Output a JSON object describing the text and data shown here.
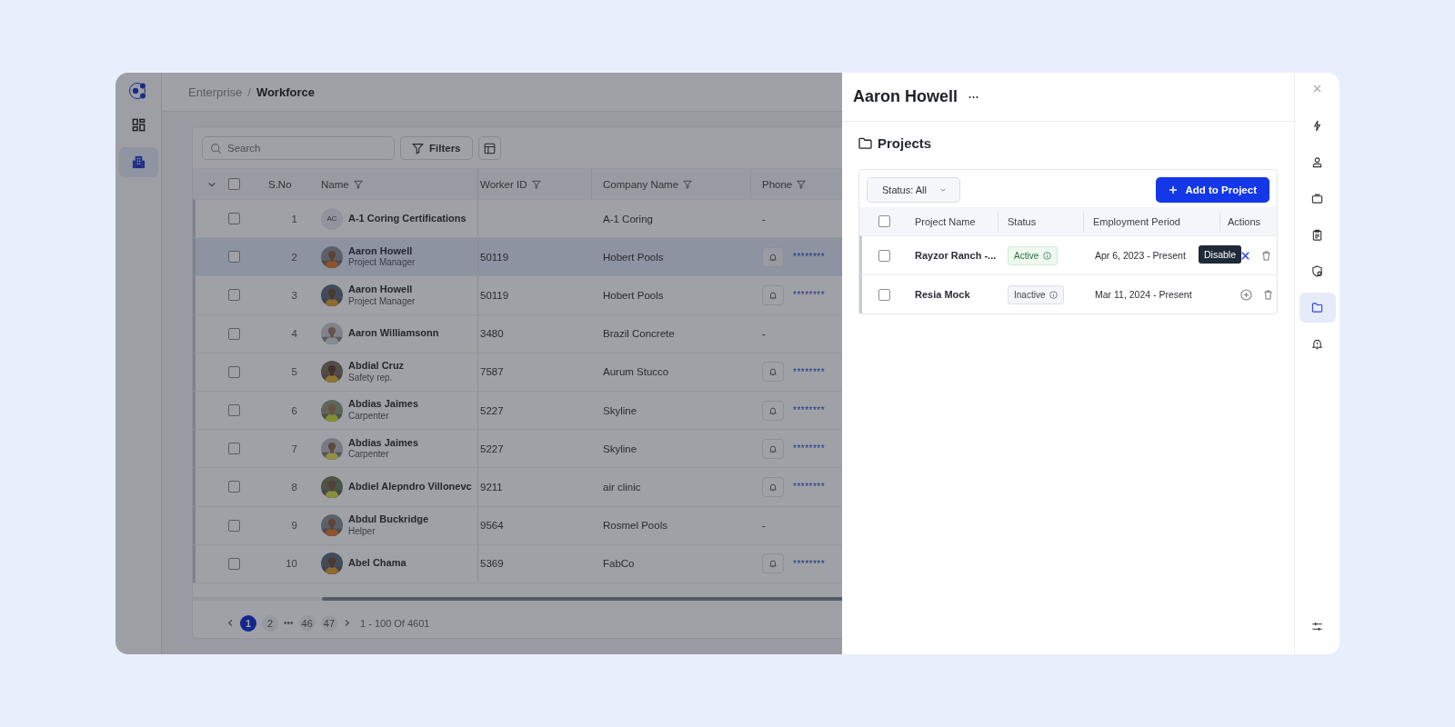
{
  "sidebar": {
    "nav": [
      {
        "selected": false
      },
      {
        "selected": true
      }
    ]
  },
  "breadcrumb": {
    "separator": "/",
    "items": [
      {
        "label": "Enterprise",
        "current": false
      },
      {
        "label": "Workforce",
        "current": true
      }
    ]
  },
  "toolbar": {
    "search": {
      "placeholder": "Search"
    },
    "filters_button": "Filters"
  },
  "table": {
    "header_checked": false,
    "columns": [
      {
        "label": "S.No",
        "filter": false
      },
      {
        "label": "Name",
        "filter": true
      },
      {
        "label": "Worker ID",
        "filter": true
      },
      {
        "label": "Company Name",
        "filter": true
      },
      {
        "label": "Phone",
        "filter": true
      }
    ],
    "rows": [
      {
        "sno": "1",
        "avatar": {
          "kind": "initials",
          "text": "AC"
        },
        "name": "A-1 Coring Certifications",
        "company": "A-1 Coring",
        "phone": "-",
        "notify": false,
        "checked": false,
        "selected": false
      },
      {
        "sno": "2",
        "name": "Aaron Howell",
        "role": "Project Manager",
        "worker_id": "50119",
        "company": "Hobert Pools",
        "phone": "********",
        "notify": true,
        "checked": false,
        "selected": true
      },
      {
        "sno": "3",
        "name": "Aaron Howell",
        "role": "Project Manager",
        "worker_id": "50119",
        "company": "Hobert Pools",
        "phone": "********",
        "notify": true,
        "checked": false,
        "selected": false
      },
      {
        "sno": "4",
        "name": "Aaron Williamsonn",
        "worker_id": "3480",
        "company": "Brazil Concrete",
        "phone": "-",
        "notify": false,
        "checked": false,
        "selected": false
      },
      {
        "sno": "5",
        "name": "Abdial Cruz",
        "role": "Safety rep.",
        "worker_id": "7587",
        "company": "Aurum Stucco",
        "phone": "********",
        "notify": true,
        "checked": false,
        "selected": false
      },
      {
        "sno": "6",
        "name": "Abdias Jaimes",
        "role": "Carpenter",
        "worker_id": "5227",
        "company": "Skyline",
        "phone": "********",
        "notify": true,
        "checked": false,
        "selected": false
      },
      {
        "sno": "7",
        "name": "Abdias Jaimes",
        "role": "Carpenter",
        "worker_id": "5227",
        "company": "Skyline",
        "phone": "********",
        "notify": true,
        "checked": false,
        "selected": false
      },
      {
        "sno": "8",
        "name": "Abdiel Alepndro Villonevc",
        "worker_id": "9211",
        "company": "air clinic",
        "phone": "********",
        "notify": true,
        "checked": false,
        "selected": false
      },
      {
        "sno": "9",
        "name": "Abdul Buckridge",
        "role": "Helper",
        "worker_id": "9564",
        "company": "Rosmel Pools",
        "phone": "-",
        "notify": false,
        "checked": false,
        "selected": false
      },
      {
        "sno": "10",
        "name": "Abel Chama",
        "worker_id": "5369",
        "company": "FabCo",
        "phone": "********",
        "notify": true,
        "checked": false,
        "selected": false
      }
    ]
  },
  "pagination": {
    "pages": [
      {
        "label": "1",
        "kind": "page",
        "selected": true
      },
      {
        "label": "2",
        "kind": "page",
        "selected": false
      },
      {
        "label": "•••",
        "kind": "ellipsis"
      },
      {
        "label": "46",
        "kind": "page",
        "selected": false
      },
      {
        "label": "47",
        "kind": "page",
        "selected": false
      }
    ],
    "summary": "1 - 100 Of 4601"
  },
  "drawer": {
    "title": "Aaron Howell",
    "section_title": "Projects",
    "status_filter": "Status: All",
    "add_button": "Add to Project",
    "header_checked": false,
    "columns": [
      "Project Name",
      "Status",
      "Employment Period",
      "Actions"
    ],
    "rows": [
      {
        "project": "Rayzor Ranch -...",
        "status": "Active",
        "active": true,
        "period": "Apr 6, 2023 - Present",
        "action": {
          "kind": "disable",
          "tooltip": "Disable"
        },
        "checked": false
      },
      {
        "project": "Resia Mock",
        "status": "Inactive",
        "active": false,
        "period": "Mar 11, 2024 - Present",
        "action": {
          "kind": "enable"
        },
        "checked": false
      }
    ]
  },
  "rail": [
    {
      "selected": false
    },
    {
      "selected": false
    },
    {
      "selected": false
    },
    {
      "selected": false
    },
    {
      "selected": false
    },
    {
      "selected": true
    },
    {
      "selected": false
    },
    {
      "selected": false
    }
  ]
}
